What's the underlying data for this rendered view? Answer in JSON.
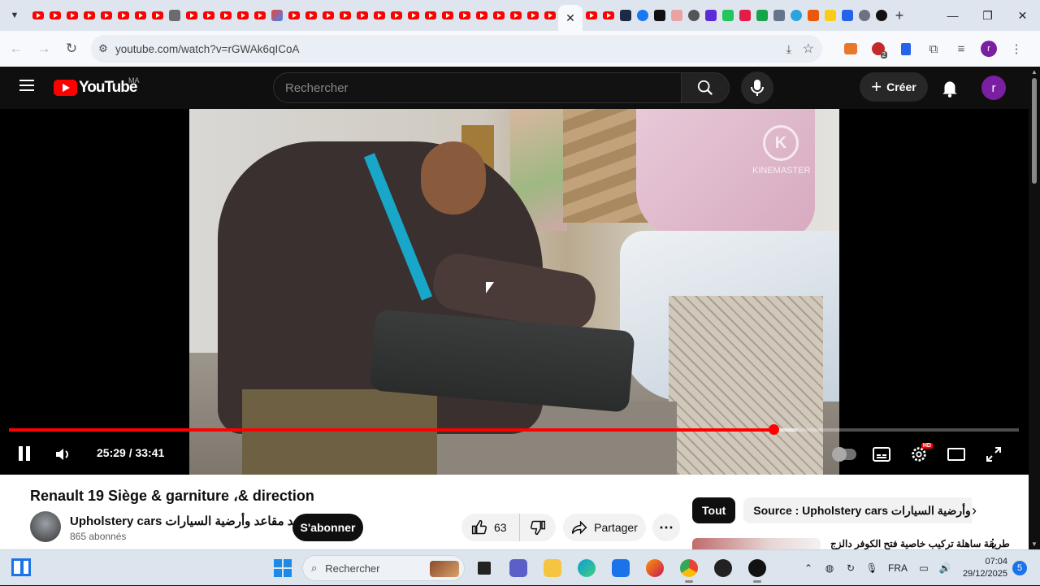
{
  "browser": {
    "url": "youtube.com/watch?v=rGWAk6qICoA",
    "new_tab": "+",
    "active_tab_close": "✕",
    "window_controls": {
      "minimize": "—",
      "maximize": "❐",
      "close": "✕"
    },
    "extension_badge": "2",
    "profile_initial": "r"
  },
  "youtube": {
    "logo_text": "YouTube",
    "country_code": "MA",
    "search_placeholder": "Rechercher",
    "create_label": "Créer",
    "create_icon": "+",
    "avatar_initial": "r"
  },
  "player": {
    "watermark": "KINEMASTER",
    "watermark_letter": "K",
    "time_current": "25:29",
    "time_total": "33:41",
    "time_display": "25:29 / 33:41",
    "progress_fraction": 0.757,
    "buffered_fraction": 0.78,
    "hd_badge": "HD"
  },
  "video": {
    "title": "Renault 19 Siège & garniture ،& direction",
    "channel_name": "Upholstery cars تجديد مقاعد وأرضية السيارات",
    "subscribers": "865 abonnés",
    "subscribe_label": "S'abonner",
    "like_count": "63",
    "share_label": "Partager",
    "more_label": "⋯"
  },
  "recommendations": {
    "chips": [
      "Tout",
      "Source : Upholstery cars تجديد مقاعد وأرضية السيارات"
    ],
    "next_label": "›",
    "first_title": "طريقة ساهلة تركيب خاصية فتح الكوفر دالزج"
  },
  "taskbar": {
    "search_placeholder": "Rechercher",
    "language": "FRA",
    "time": "07:04",
    "date": "29/12/2025",
    "notifications": "5"
  },
  "colors": {
    "brand_red": "#ff0000",
    "page_dark": "#0f0f0f",
    "taskbar": "#dce4ee"
  }
}
